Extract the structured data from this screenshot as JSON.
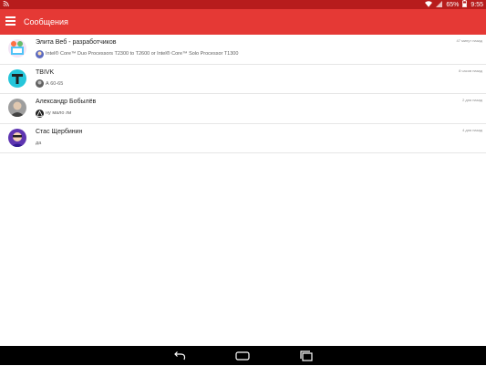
{
  "status": {
    "left_icon": "cast-icon",
    "battery": "65%",
    "time": "9:55"
  },
  "app": {
    "title": "Сообщения",
    "accent": "#e53935",
    "status_color": "#b71c1c"
  },
  "conversations": [
    {
      "name": "Элита Веб - разработчиков",
      "time": "47 минут назад",
      "preview": "Intel® Core™ Duo Processors T2300 to T2600 or Intel® Core™ Solo Processor T1300"
    },
    {
      "name": "TBIVK",
      "time": "8 часов назад",
      "preview": "А 60-65"
    },
    {
      "name": "Александр Бобылёв",
      "time": "2 дня назад",
      "preview": "ну мало ли"
    },
    {
      "name": "Стас Щербинин",
      "time": "4 дня назад",
      "preview": "да"
    }
  ],
  "navigation": {
    "back": "back-icon",
    "home": "home-icon",
    "recents": "recents-icon"
  }
}
